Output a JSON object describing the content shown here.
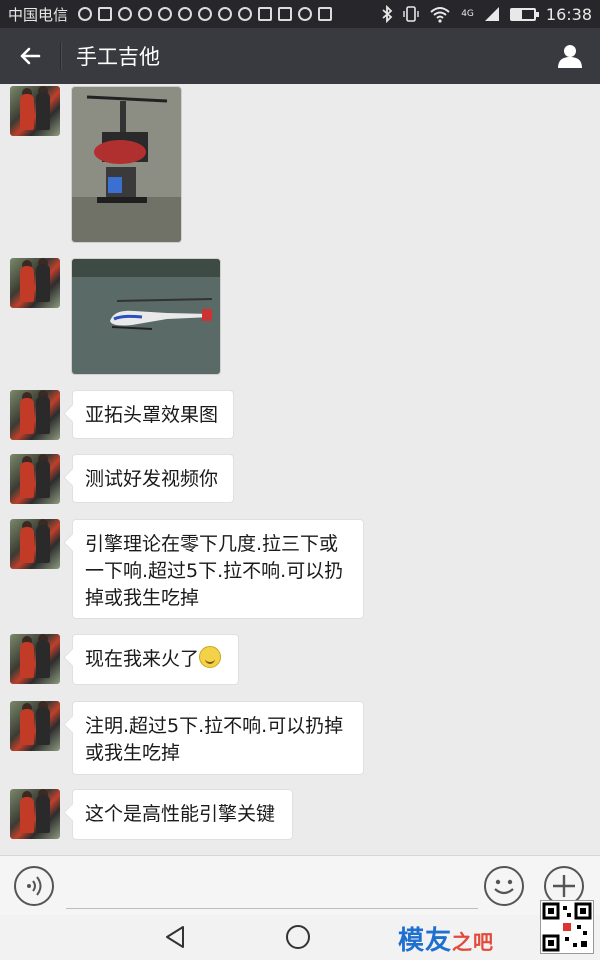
{
  "status_bar": {
    "carrier": "中国电信",
    "network": "4G",
    "battery_level": 0.45,
    "time": "16:38"
  },
  "header": {
    "title": "手工吉他",
    "back_icon": "arrow-left-icon",
    "profile_icon": "person-icon"
  },
  "messages": [
    {
      "type": "image",
      "subject": "helicopter-frame-photo"
    },
    {
      "type": "image",
      "subject": "helicopter-on-floor-photo"
    },
    {
      "type": "text",
      "text": "亚拓头罩效果图"
    },
    {
      "type": "text",
      "text": "测试好发视频你"
    },
    {
      "type": "text",
      "lines": [
        "引擎理论在零下几度.拉三下或",
        "一下响.超过5下.拉不响.可以扔",
        "掉或我生吃掉"
      ]
    },
    {
      "type": "text",
      "text": "现在我来火了",
      "emoji": "smile-emoji"
    },
    {
      "type": "text",
      "lines": [
        "注明.超过5下.拉不响.可以扔掉",
        "或我生吃掉"
      ]
    },
    {
      "type": "text",
      "text": "这个是高性能引擎关键"
    }
  ],
  "input_bar": {
    "voice_icon": "voice-icon",
    "input_value": "",
    "emoji_icon": "smiley-icon",
    "plus_icon": "plus-icon"
  },
  "watermark": {
    "text": "模友",
    "suffix": "之吧"
  },
  "colors": {
    "header_bg": "#393a3f",
    "chat_bg": "#ebebeb",
    "bubble_bg": "#ffffff"
  }
}
